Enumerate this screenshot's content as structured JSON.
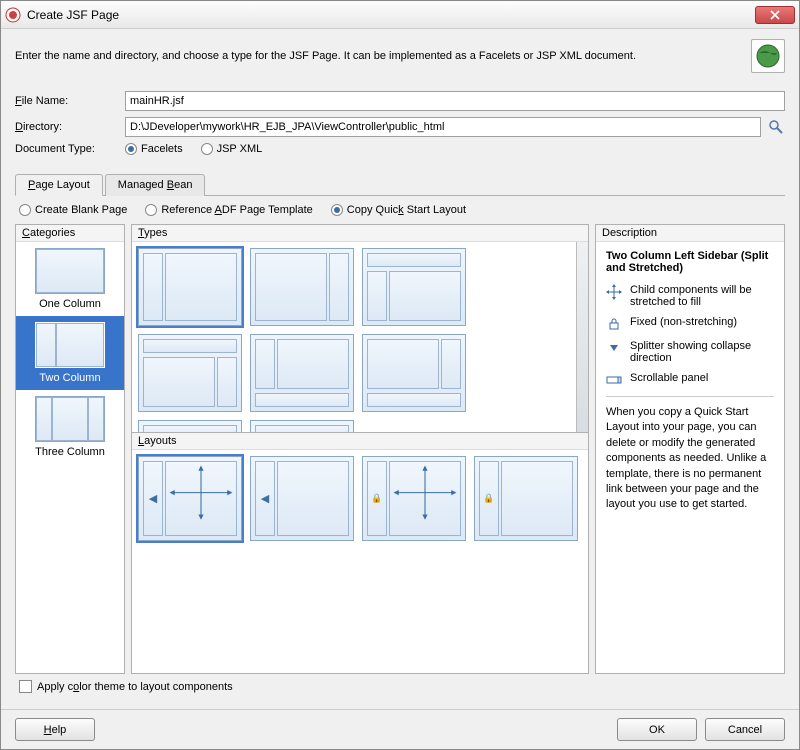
{
  "titlebar": {
    "title": "Create JSF Page"
  },
  "instruction": "Enter the name and directory, and choose a type for the JSF Page. It can be implemented as a Facelets or JSP XML document.",
  "form": {
    "fileNameLabel": "File Name:",
    "fileName": "mainHR.jsf",
    "directoryLabel": "Directory:",
    "directory": "D:\\JDeveloper\\mywork\\HR_EJB_JPA\\ViewController\\public_html",
    "docTypeLabel": "Document Type:",
    "facelets": "Facelets",
    "jspxml": "JSP XML"
  },
  "tabs": {
    "pageLayout": "Page Layout",
    "managedBean": "Managed Bean"
  },
  "layoutOptions": {
    "blank": "Create Blank Page",
    "reference": "Reference ADF Page Template",
    "copy": "Copy Quick Start Layout"
  },
  "headers": {
    "categories": "Categories",
    "types": "Types",
    "layouts": "Layouts",
    "description": "Description"
  },
  "categories": {
    "one": "One Column",
    "two": "Two Column",
    "three": "Three Column"
  },
  "description": {
    "title": "Two Column Left Sidebar (Split and Stretched)",
    "stretch": "Child components will be stretched to fill",
    "fixed": "Fixed (non-stretching)",
    "splitter": "Splitter showing collapse direction",
    "scrollable": "Scrollable panel",
    "note": "When you copy a Quick Start Layout into your page, you can delete or modify the generated components as needed. Unlike a template, there is no permanent link between your page and the layout you use to get started."
  },
  "applyTheme": "Apply color theme to layout components",
  "buttons": {
    "help": "Help",
    "ok": "OK",
    "cancel": "Cancel"
  }
}
